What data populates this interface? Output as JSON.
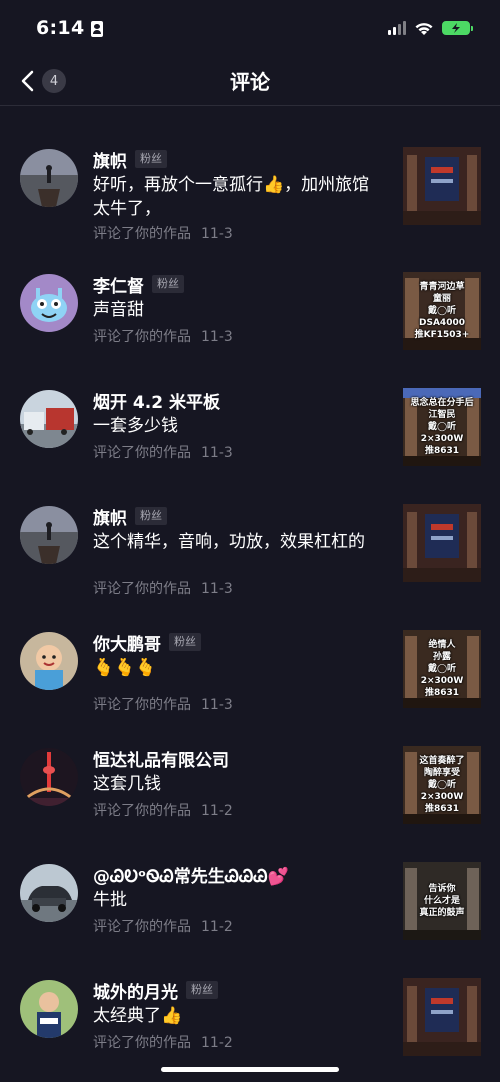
{
  "status": {
    "time": "6:14"
  },
  "nav": {
    "back_count": "4",
    "title": "评论"
  },
  "comments": [
    {
      "name": "旗帜",
      "tag": "粉丝",
      "text": "好听，再放个一意孤行👍，加州旅馆太牛了，",
      "action": "评论了你的作品",
      "date": "11-3",
      "avatar": "pier-scene",
      "thumb_lines": [
        "",
        "",
        "",
        ""
      ]
    },
    {
      "name": "李仁督",
      "tag": "粉丝",
      "text": "声音甜",
      "action": "评论了你的作品",
      "date": "11-3",
      "avatar": "alien-cartoon",
      "thumb_lines": [
        "青青河边草",
        "童丽",
        "戴◯听",
        "DSA4000",
        "推KF1503+"
      ]
    },
    {
      "name": "烟开 4.2 米平板",
      "tag": "",
      "text": "一套多少钱",
      "action": "评论了你的作品",
      "date": "11-3",
      "avatar": "trucks",
      "thumb_lines": [
        "思念总在分手后",
        "江智民",
        "戴◯听",
        "2×300W",
        "推8631"
      ]
    },
    {
      "name": "旗帜",
      "tag": "粉丝",
      "text": "这个精华，音响，功放，效果杠杠的",
      "action": "评论了你的作品",
      "date": "11-3",
      "avatar": "pier-scene",
      "thumb_lines": [
        "",
        "",
        "",
        ""
      ]
    },
    {
      "name": "你大鹏哥",
      "tag": "粉丝",
      "text": "🫰🫰🫰",
      "action": "评论了你的作品",
      "date": "11-3",
      "avatar": "baby-photo",
      "thumb_lines": [
        "绝情人",
        "孙露",
        "戴◯听",
        "2×300W",
        "推8631"
      ]
    },
    {
      "name": "恒达礼品有限公司",
      "tag": "",
      "text": "这套几钱",
      "action": "评论了你的作品",
      "date": "11-2",
      "avatar": "tower-night",
      "thumb_lines": [
        "这首奏醉了",
        "陶醉享受",
        "戴◯听",
        "2×300W",
        "推8631"
      ]
    },
    {
      "name": "@ᏊᎧᵒᏫᏊ常先生ᏊᏊᏊ💕",
      "tag": "",
      "text": "牛批",
      "action": "评论了你的作品",
      "date": "11-2",
      "avatar": "car-photo",
      "thumb_lines": [
        "告诉你",
        "什么才是",
        "真正的鼓声"
      ]
    },
    {
      "name": "城外的月光",
      "tag": "粉丝",
      "text": "太经典了👍",
      "action": "评论了你的作品",
      "date": "11-2",
      "avatar": "kid-photo",
      "thumb_lines": [
        "",
        "",
        "",
        ""
      ]
    }
  ]
}
